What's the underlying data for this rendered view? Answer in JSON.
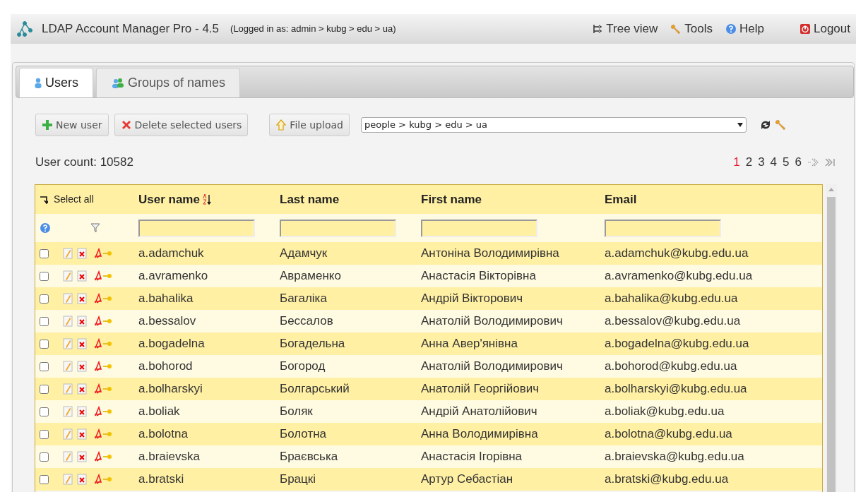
{
  "header": {
    "title": "LDAP Account Manager Pro - 4.5",
    "login": "(Logged in as: admin > kubg > edu > ua)",
    "links": [
      {
        "kind": "tree",
        "label": "Tree view"
      },
      {
        "kind": "tools",
        "label": "Tools"
      },
      {
        "kind": "help",
        "label": "Help"
      },
      {
        "kind": "logout",
        "label": "Logout"
      }
    ]
  },
  "tabs": [
    {
      "kind": "user",
      "label": "Users",
      "selected": true
    },
    {
      "kind": "group",
      "label": "Groups of names",
      "selected": false
    }
  ],
  "toolbar": {
    "buttons": [
      {
        "kind": "new",
        "label": "New user"
      },
      {
        "kind": "delete",
        "label": "Delete selected users"
      },
      {
        "kind": "upload",
        "label": "File upload"
      }
    ],
    "suffix": "people > kubg > edu > ua"
  },
  "count": "User count: 10582",
  "pages": [
    {
      "label": "1",
      "selected": true
    },
    {
      "label": "2",
      "selected": false
    },
    {
      "label": "3",
      "selected": false
    },
    {
      "label": "4",
      "selected": false
    },
    {
      "label": "5",
      "selected": false
    },
    {
      "label": "6",
      "selected": false
    }
  ],
  "table": {
    "select_all": "Select all",
    "columns": [
      {
        "label": "User name",
        "sorted": true
      },
      {
        "label": "Last name",
        "sorted": false
      },
      {
        "label": "First name",
        "sorted": false
      },
      {
        "label": "Email",
        "sorted": false
      }
    ],
    "rows": [
      {
        "checked": false,
        "cells": [
          "a.adamchuk",
          "Адамчук",
          "Антоніна Володимирівна",
          "a.adamchuk@kubg.edu.ua"
        ]
      },
      {
        "checked": false,
        "cells": [
          "a.avramenko",
          "Авраменко",
          "Анастасія Вікторівна",
          "a.avramenko@kubg.edu.ua"
        ]
      },
      {
        "checked": false,
        "cells": [
          "a.bahalika",
          "Багаліка",
          "Андрій Вікторович",
          "a.bahalika@kubg.edu.ua"
        ]
      },
      {
        "checked": false,
        "cells": [
          "a.bessalov",
          "Бессалов",
          "Анатолій Володимирович",
          "a.bessalov@kubg.edu.ua"
        ]
      },
      {
        "checked": false,
        "cells": [
          "a.bogadelna",
          "Богадельна",
          "Анна Авер'янівна",
          "a.bogadelna@kubg.edu.ua"
        ]
      },
      {
        "checked": false,
        "cells": [
          "a.bohorod",
          "Богород",
          "Анатолій Володимирович",
          "a.bohorod@kubg.edu.ua"
        ]
      },
      {
        "checked": false,
        "cells": [
          "a.bolharskyi",
          "Болгарський",
          "Анатолій Георгійович",
          "a.bolharskyi@kubg.edu.ua"
        ]
      },
      {
        "checked": false,
        "cells": [
          "a.boliak",
          "Боляк",
          "Андрій Анатолійович",
          "a.boliak@kubg.edu.ua"
        ]
      },
      {
        "checked": false,
        "cells": [
          "a.bolotna",
          "Болотна",
          "Анна Володимирівна",
          "a.bolotna@kubg.edu.ua"
        ]
      },
      {
        "checked": false,
        "cells": [
          "a.braievska",
          "Браєвська",
          "Анастасія Ігорівна",
          "a.braievska@kubg.edu.ua"
        ]
      },
      {
        "checked": false,
        "cells": [
          "a.bratski",
          "Брацкі",
          "Артур Себастіан",
          "a.bratski@kubg.edu.ua"
        ]
      }
    ]
  }
}
